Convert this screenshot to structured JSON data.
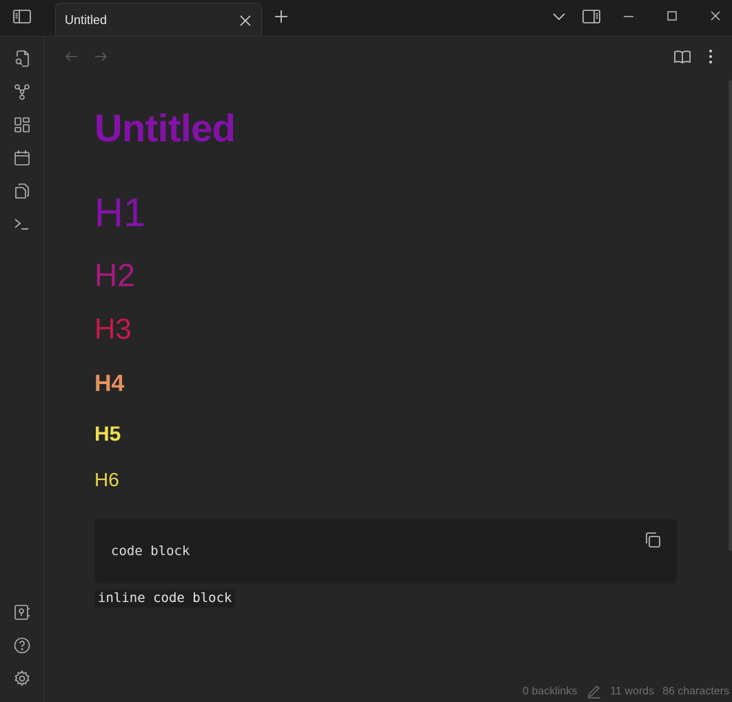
{
  "window": {
    "tab_title": "Untitled"
  },
  "titlebar": {
    "icons": [
      "sidebar-toggle-icon",
      "close-icon",
      "plus-icon",
      "chevron-down-icon",
      "right-sidebar-icon",
      "minimize-icon",
      "maximize-icon",
      "window-close-icon"
    ]
  },
  "ribbon": {
    "icons": [
      "search-file-icon",
      "graph-icon",
      "canvas-icon",
      "calendar-icon",
      "files-icon",
      "terminal-icon",
      "vault-icon",
      "help-icon",
      "settings-icon"
    ]
  },
  "document": {
    "title": "Untitled",
    "headings": {
      "h1": "H1",
      "h2": "H2",
      "h3": "H3",
      "h4": "H4",
      "h5": "H5",
      "h6": "H6"
    },
    "code_block": "code block",
    "inline_code": "inline code block"
  },
  "status_bar": {
    "backlinks": "0 backlinks",
    "words": "11 words",
    "characters": "86 characters"
  },
  "colors": {
    "title": "#8412a9",
    "h1": "#8412a9",
    "h2": "#a61a7e",
    "h3": "#c8194e",
    "h4": "#e5915e",
    "h5": "#f0e04e",
    "h6": "#e5d64a",
    "background": "#262626"
  }
}
